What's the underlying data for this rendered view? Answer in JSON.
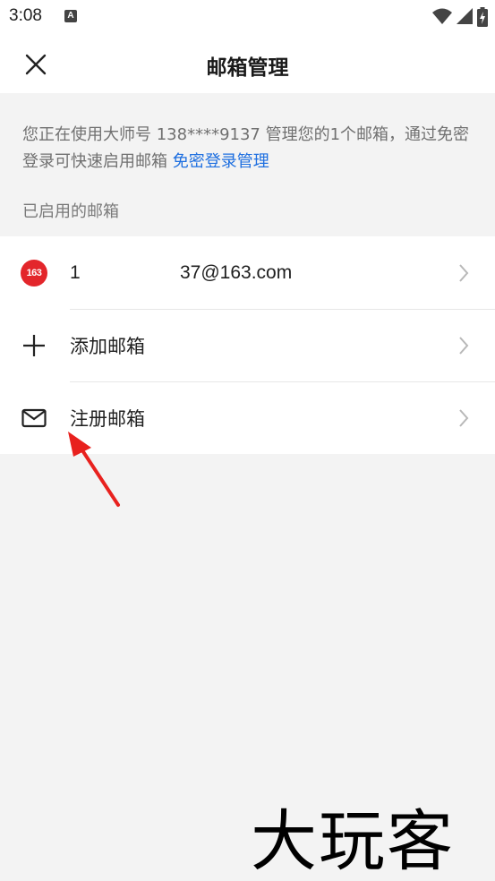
{
  "status_bar": {
    "time": "3:08",
    "notification_icon": "a-icon",
    "wifi_icon": "wifi-icon",
    "signal_icon": "signal-icon",
    "battery_icon": "battery-charging-icon"
  },
  "header": {
    "title": "邮箱管理",
    "close_icon": "close-icon"
  },
  "info": {
    "text": "您正在使用大师号 138****9137 管理您的1个邮箱，通过免密登录可快速启用邮箱 ",
    "link": "免密登录管理"
  },
  "section_label": "已启用的邮箱",
  "list": {
    "account": {
      "badge": "163",
      "prefix": "1",
      "email": "37@163.com"
    },
    "add_label": "添加邮箱",
    "register_label": "注册邮箱"
  },
  "watermark": "大玩客",
  "colors": {
    "link": "#1e6fe0",
    "brand_163": "#e3262b",
    "annotation_arrow": "#e8211e",
    "background": "#f3f3f3"
  }
}
